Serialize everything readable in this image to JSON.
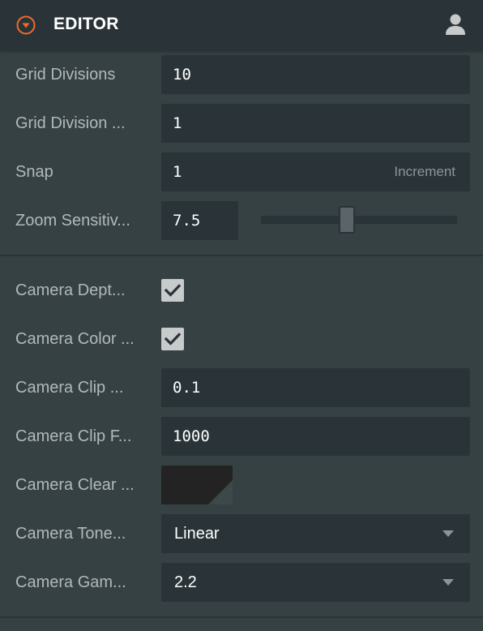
{
  "header": {
    "title": "EDITOR",
    "toggle_icon": "collapse-arrow-icon",
    "user_icon": "user-icon"
  },
  "settings": {
    "grid_divisions": {
      "label": "Grid Divisions",
      "value": "10"
    },
    "grid_division_size": {
      "label": "Grid Division ...",
      "value": "1"
    },
    "snap": {
      "label": "Snap",
      "value": "1",
      "suffix": "Increment"
    },
    "zoom_sensitivity": {
      "label": "Zoom Sensitiv...",
      "value": "7.5",
      "slider_fraction": 0.42
    },
    "camera_depth": {
      "label": "Camera Dept...",
      "checked": true
    },
    "camera_color": {
      "label": "Camera Color ...",
      "checked": true
    },
    "camera_clip_near": {
      "label": "Camera Clip ...",
      "value": "0.1"
    },
    "camera_clip_far": {
      "label": "Camera Clip F...",
      "value": "1000"
    },
    "camera_clear_color": {
      "label": "Camera Clear ...",
      "color": "#232323"
    },
    "camera_tonemapping": {
      "label": "Camera Tone...",
      "value": "Linear"
    },
    "camera_gamma": {
      "label": "Camera Gam...",
      "value": "2.2"
    }
  },
  "colors": {
    "accent": "#f06a28",
    "panel_bg": "#364144",
    "field_bg": "#2a3438",
    "text": "#b1b8ba"
  }
}
